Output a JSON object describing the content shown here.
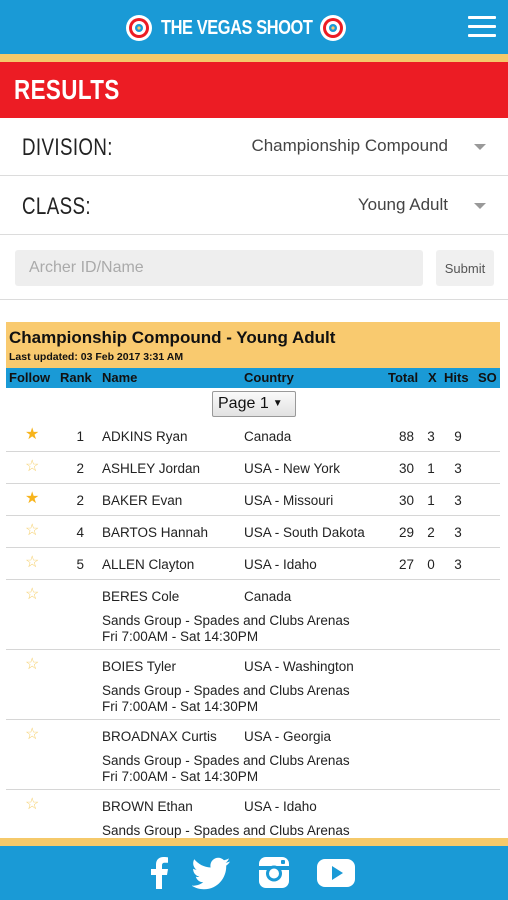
{
  "header": {
    "app_title": "THE VEGAS SHOOT",
    "results_title": "RESULTS"
  },
  "filters": {
    "division_label": "DIVISION:",
    "division_value": "Championship Compound",
    "class_label": "CLASS:",
    "class_value": "Young Adult"
  },
  "search": {
    "placeholder": "Archer ID/Name",
    "submit_label": "Submit"
  },
  "results": {
    "title": "Championship Compound - Young Adult",
    "last_updated": "Last updated: 03 Feb 2017 3:31 AM",
    "columns": {
      "follow": "Follow",
      "rank": "Rank",
      "name": "Name",
      "country": "Country",
      "total": "Total",
      "x": "X",
      "hits": "Hits",
      "so": "SO"
    },
    "page_select": "Page 1",
    "ranked": [
      {
        "followed": true,
        "rank": "1",
        "name": "ADKINS Ryan",
        "country": "Canada",
        "total": "88",
        "x": "3",
        "hits": "9"
      },
      {
        "followed": false,
        "rank": "2",
        "name": "ASHLEY Jordan",
        "country": "USA - New York",
        "total": "30",
        "x": "1",
        "hits": "3"
      },
      {
        "followed": true,
        "rank": "2",
        "name": "BAKER Evan",
        "country": "USA - Missouri",
        "total": "30",
        "x": "1",
        "hits": "3"
      },
      {
        "followed": false,
        "rank": "4",
        "name": "BARTOS Hannah",
        "country": "USA - South Dakota",
        "total": "29",
        "x": "2",
        "hits": "3"
      },
      {
        "followed": false,
        "rank": "5",
        "name": "ALLEN Clayton",
        "country": "USA - Idaho",
        "total": "27",
        "x": "0",
        "hits": "3"
      }
    ],
    "unranked": [
      {
        "followed": false,
        "name": "BERES Cole",
        "country": "Canada",
        "location": "Sands Group - Spades and Clubs Arenas",
        "time": "Fri 7:00AM - Sat 14:30PM"
      },
      {
        "followed": false,
        "name": "BOIES Tyler",
        "country": "USA - Washington",
        "location": "Sands Group - Spades and Clubs Arenas",
        "time": "Fri 7:00AM - Sat 14:30PM"
      },
      {
        "followed": false,
        "name": "BROADNAX Curtis",
        "country": "USA - Georgia",
        "location": "Sands Group - Spades and Clubs Arenas",
        "time": "Fri 7:00AM - Sat 14:30PM"
      },
      {
        "followed": false,
        "name": "BROWN Ethan",
        "country": "USA - Idaho",
        "location": "Sands Group - Spades and Clubs Arenas",
        "time": ""
      }
    ]
  },
  "footer": {
    "icons": [
      "facebook-icon",
      "twitter-icon",
      "instagram-icon",
      "youtube-icon"
    ]
  },
  "colors": {
    "header_blue": "#1a9ad6",
    "results_red": "#ec1c24",
    "accent_gold": "#f9ca6f",
    "star_gold": "#f7b41c"
  }
}
